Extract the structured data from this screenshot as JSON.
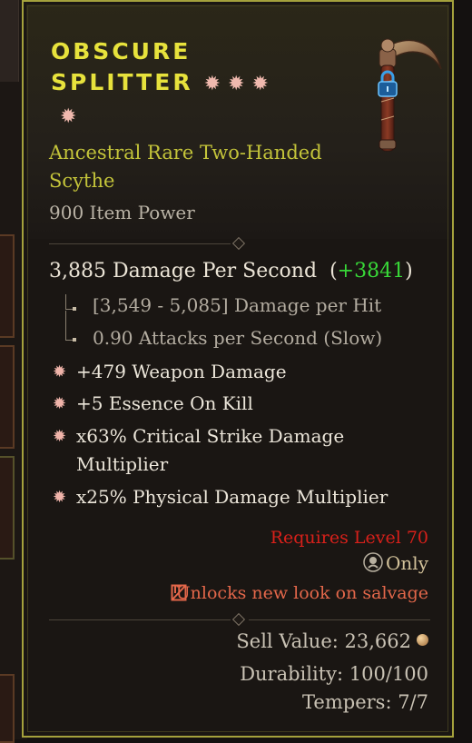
{
  "item": {
    "name_line1": "Obscure",
    "name_line2": "Splitter",
    "sockets": [
      "socket-gem",
      "socket-gem",
      "socket-gem",
      "socket-gem"
    ],
    "rarity_type": "Ancestral Rare Two-Handed Scythe",
    "item_power": "900 Item Power",
    "locked": true
  },
  "stats": {
    "dps_label": "3,885 Damage Per Second",
    "dps_open": "(",
    "dps_delta": "+3841",
    "dps_close": ")",
    "damage_per_hit": "[3,549 - 5,085] Damage per Hit",
    "attacks_per_second": "0.90 Attacks per Second (Slow)"
  },
  "affixes": [
    "+479 Weapon Damage",
    "+5 Essence On Kill",
    "x63% Critical Strike Damage Multiplier",
    "x25% Physical Damage Multiplier"
  ],
  "requirements": {
    "level": "Requires Level 70",
    "class_only": "Only",
    "unlock_note": "Unlocks new look on salvage"
  },
  "footer": {
    "sell_value": "Sell Value: 23,662",
    "durability": "Durability: 100/100",
    "tempers": "Tempers: 7/7"
  },
  "colors": {
    "title": "#e7e23c",
    "rarity": "#c4c43a",
    "border": "#a4a13c",
    "delta": "#38d838",
    "requirement": "#d7201a",
    "unlock": "#e3674a"
  },
  "icons": {
    "affix_bullet": "burst-star-icon",
    "lock": "padlock-icon",
    "class": "class-emblem-icon",
    "unlock": "transmog-icon",
    "currency": "gold-coin-icon"
  }
}
